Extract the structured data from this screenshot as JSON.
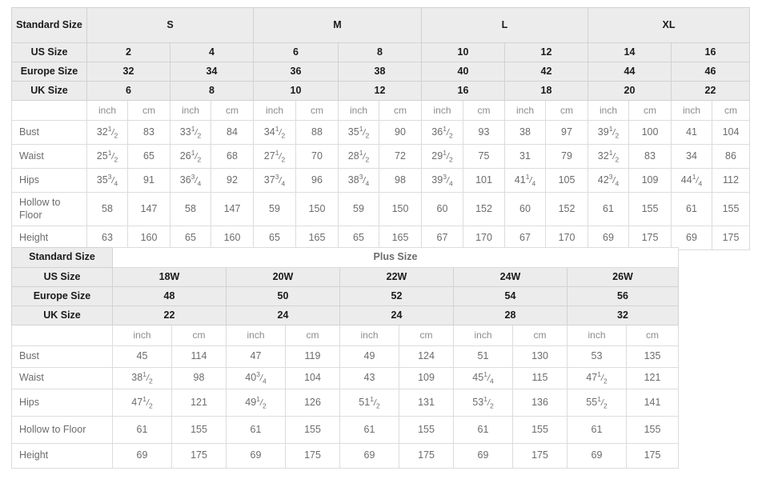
{
  "table1": {
    "name": "standard-size-chart",
    "row_labels": {
      "standard_size": "Standard Size",
      "us_size": "US Size",
      "europe_size": "Europe Size",
      "uk_size": "UK Size",
      "bust": "Bust",
      "waist": "Waist",
      "hips": "Hips",
      "hollow_to_floor": "Hollow to Floor",
      "height": "Height"
    },
    "standard_sizes": [
      "S",
      "M",
      "L",
      "XL"
    ],
    "us_sizes": [
      "2",
      "4",
      "6",
      "8",
      "10",
      "12",
      "14",
      "16"
    ],
    "europe_sizes": [
      "32",
      "34",
      "36",
      "38",
      "40",
      "42",
      "44",
      "46"
    ],
    "uk_sizes": [
      "6",
      "8",
      "10",
      "12",
      "16",
      "18",
      "20",
      "22"
    ],
    "unit_inch": "inch",
    "unit_cm": "cm",
    "bust": {
      "inch": [
        "32 1/2",
        "33 1/2",
        "34 1/2",
        "35 1/2",
        "36 1/2",
        "38",
        "39 1/2",
        "41"
      ],
      "cm": [
        "83",
        "84",
        "88",
        "90",
        "93",
        "97",
        "100",
        "104"
      ]
    },
    "waist": {
      "inch": [
        "25 1/2",
        "26 1/2",
        "27 1/2",
        "28 1/2",
        "29 1/2",
        "31",
        "32 1/2",
        "34"
      ],
      "cm": [
        "65",
        "68",
        "70",
        "72",
        "75",
        "79",
        "83",
        "86"
      ]
    },
    "hips": {
      "inch": [
        "35 3/4",
        "36 3/4",
        "37 3/4",
        "38 3/4",
        "39 3/4",
        "41 1/4",
        "42 3/4",
        "44 1/4"
      ],
      "cm": [
        "91",
        "92",
        "96",
        "98",
        "101",
        "105",
        "109",
        "112"
      ]
    },
    "hollow_to_floor": {
      "inch": [
        "58",
        "58",
        "59",
        "59",
        "60",
        "60",
        "61",
        "61"
      ],
      "cm": [
        "147",
        "147",
        "150",
        "150",
        "152",
        "152",
        "155",
        "155"
      ]
    },
    "height": {
      "inch": [
        "63",
        "65",
        "65",
        "65",
        "67",
        "67",
        "69",
        "69"
      ],
      "cm": [
        "160",
        "160",
        "165",
        "165",
        "170",
        "170",
        "175",
        "175"
      ]
    }
  },
  "table2": {
    "name": "plus-size-chart",
    "row_labels": {
      "standard_size": "Standard Size",
      "us_size": "US Size",
      "europe_size": "Europe Size",
      "uk_size": "UK Size",
      "bust": "Bust",
      "waist": "Waist",
      "hips": "Hips",
      "hollow_to_floor": "Hollow to Floor",
      "height": "Height"
    },
    "group_label": "Plus Size",
    "us_sizes": [
      "18W",
      "20W",
      "22W",
      "24W",
      "26W"
    ],
    "europe_sizes": [
      "48",
      "50",
      "52",
      "54",
      "56"
    ],
    "uk_sizes": [
      "22",
      "24",
      "24",
      "28",
      "32"
    ],
    "unit_inch": "inch",
    "unit_cm": "cm",
    "bust": {
      "inch": [
        "45",
        "47",
        "49",
        "51",
        "53"
      ],
      "cm": [
        "114",
        "119",
        "124",
        "130",
        "135"
      ]
    },
    "waist": {
      "inch": [
        "38 1/2",
        "40 3/4",
        "43",
        "45 1/4",
        "47 1/2"
      ],
      "cm": [
        "98",
        "104",
        "109",
        "115",
        "121"
      ]
    },
    "hips": {
      "inch": [
        "47 1/2",
        "49 1/2",
        "51 1/2",
        "53 1/2",
        "55 1/2"
      ],
      "cm": [
        "121",
        "126",
        "131",
        "136",
        "141"
      ]
    },
    "hollow_to_floor": {
      "inch": [
        "61",
        "61",
        "61",
        "61",
        "61"
      ],
      "cm": [
        "155",
        "155",
        "155",
        "155",
        "155"
      ]
    },
    "height": {
      "inch": [
        "69",
        "69",
        "69",
        "69",
        "69"
      ],
      "cm": [
        "175",
        "175",
        "175",
        "175",
        "175"
      ]
    }
  },
  "colors": {
    "header_bg": "#ececec",
    "border": "#dcdcdc",
    "text_dark": "#1a1a1a",
    "text_body": "#6c6c6c"
  }
}
